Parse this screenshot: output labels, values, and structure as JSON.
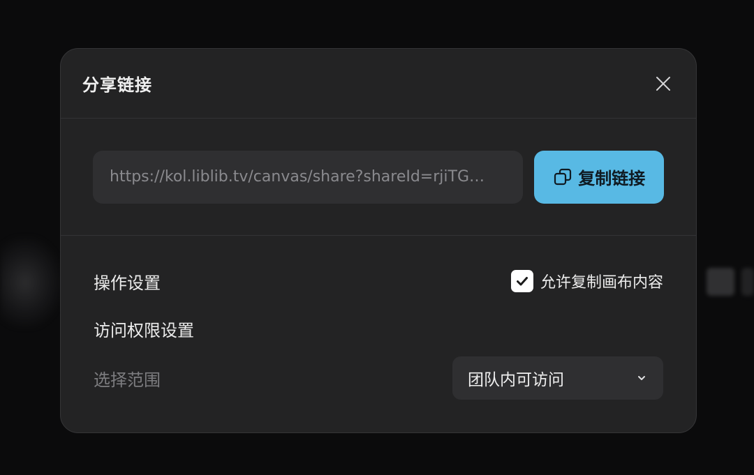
{
  "dialog": {
    "title": "分享链接",
    "close_icon": "close-icon"
  },
  "share": {
    "url": "https://kol.liblib.tv/canvas/share?shareId=rjiTG…",
    "copy_button_label": "复制链接",
    "copy_icon": "copy-icon",
    "accent_color": "#58b9e4"
  },
  "settings": {
    "operation_label": "操作设置",
    "allow_copy_label": "允许复制画布内容",
    "allow_copy_checked": true,
    "access_label": "访问权限设置",
    "scope_label": "选择范围",
    "scope_value": "团队内可访问",
    "scope_icon": "chevron-down-icon"
  }
}
